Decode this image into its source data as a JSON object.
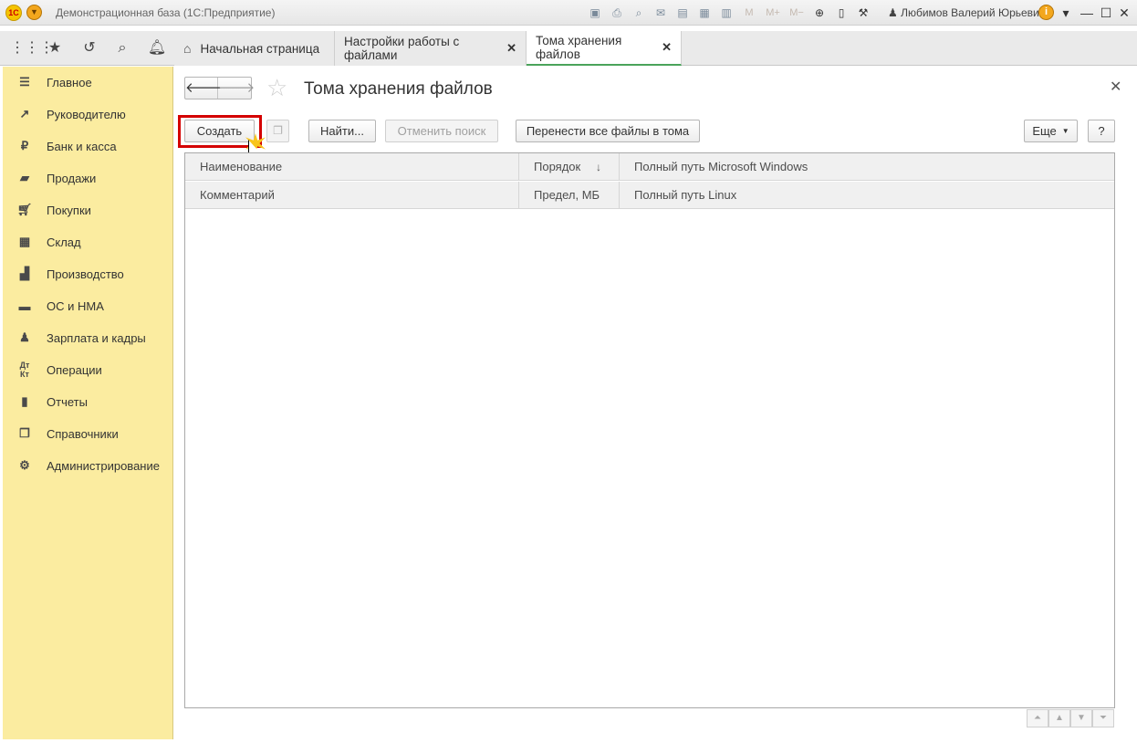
{
  "titlebar": {
    "logo_text": "1С",
    "app_title": "Демонстрационная база  (1С:Предприятие)",
    "user_name": "Любимов Валерий Юрьевич",
    "memory_buttons": [
      "M",
      "M+",
      "M−"
    ]
  },
  "tabs": [
    {
      "label": "Начальная страница"
    },
    {
      "label": "Настройки работы с файлами",
      "close": "✕"
    },
    {
      "label": "Тома хранения файлов",
      "close": "✕"
    }
  ],
  "sidebar": {
    "items": [
      {
        "label": "Главное",
        "icon": "menu-lines-icon"
      },
      {
        "label": "Руководителю",
        "icon": "trend-icon"
      },
      {
        "label": "Банк и касса",
        "icon": "ruble-icon"
      },
      {
        "label": "Продажи",
        "icon": "bag-icon"
      },
      {
        "label": "Покупки",
        "icon": "cart-icon"
      },
      {
        "label": "Склад",
        "icon": "warehouse-icon"
      },
      {
        "label": "Производство",
        "icon": "factory-icon"
      },
      {
        "label": "ОС и НМА",
        "icon": "truck-icon"
      },
      {
        "label": "Зарплата и кадры",
        "icon": "person-icon"
      },
      {
        "label": "Операции",
        "icon": "dt-kt-icon"
      },
      {
        "label": "Отчеты",
        "icon": "bar-chart-icon"
      },
      {
        "label": "Справочники",
        "icon": "books-icon"
      },
      {
        "label": "Администрирование",
        "icon": "gear-icon"
      }
    ]
  },
  "form": {
    "title": "Тома хранения файлов",
    "buttons": {
      "create": "Создать",
      "find": "Найти...",
      "cancel_search": "Отменить поиск",
      "move_files": "Перенести все файлы в тома",
      "more": "Еще",
      "help": "?"
    },
    "columns_row1": [
      "Наименование",
      "Порядок",
      "Полный путь Microsoft Windows"
    ],
    "columns_row2": [
      "Комментарий",
      "Предел, МБ",
      "Полный путь Linux"
    ],
    "sort_indicator": "↓"
  },
  "colors": {
    "sidebar_bg": "#fbeca0",
    "active_tab_underline": "#4aa35a",
    "highlight_frame": "#d40000"
  }
}
